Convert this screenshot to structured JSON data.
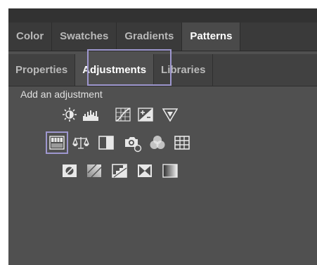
{
  "panel_tabs": [
    "Color",
    "Swatches",
    "Gradients",
    "Patterns"
  ],
  "panel_tabs_active": "Patterns",
  "sub_tabs": [
    "Properties",
    "Adjustments",
    "Libraries"
  ],
  "sub_tabs_active": "Adjustments",
  "section_caption": "Add an adjustment",
  "adjustment_icons": {
    "row1": [
      "brightness-contrast-icon",
      "levels-icon",
      "curves-icon",
      "exposure-icon",
      "vibrance-icon"
    ],
    "row2": [
      "hue-saturation-icon",
      "color-balance-icon",
      "black-white-icon",
      "photo-filter-icon",
      "channel-mixer-icon",
      "color-lookup-icon"
    ],
    "row3": [
      "invert-icon",
      "posterize-icon",
      "threshold-icon",
      "selective-color-icon",
      "gradient-map-icon"
    ]
  },
  "highlight_color": "#9e97cf"
}
